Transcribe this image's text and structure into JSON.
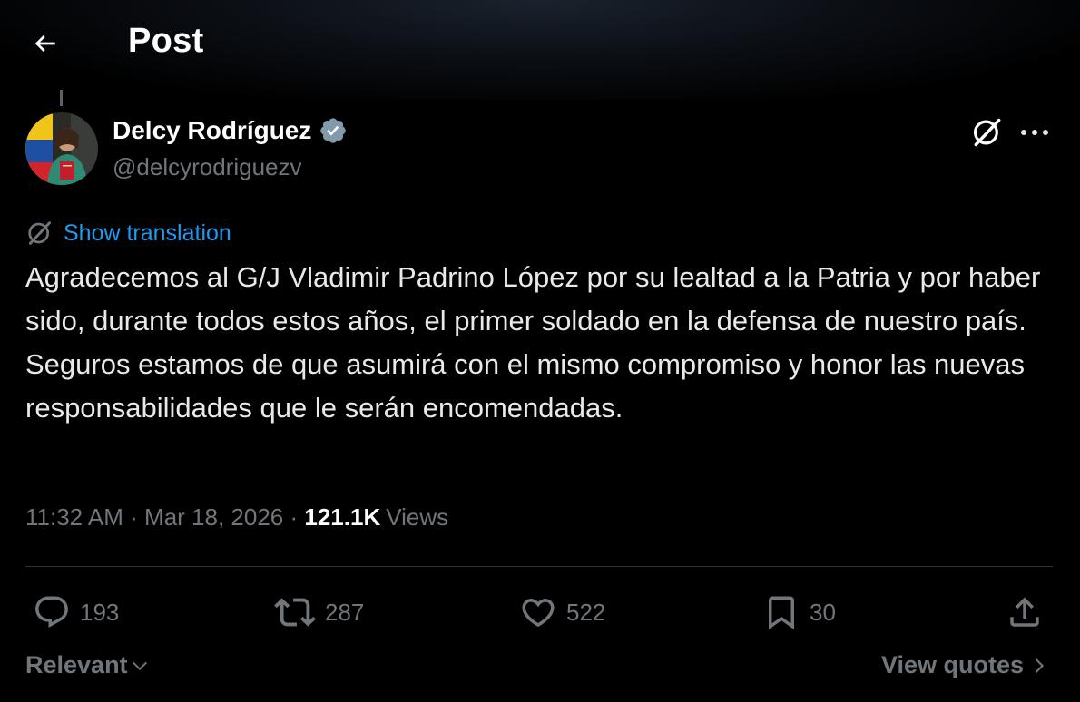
{
  "header": {
    "title": "Post"
  },
  "author": {
    "name": "Delcy Rodríguez",
    "handle": "@delcyrodriguezv",
    "verified": true
  },
  "translate": {
    "label": "Show translation"
  },
  "post": {
    "text": "Agradecemos al G/J Vladimir Padrino López por su lealtad a la Patria y por haber sido, durante todos estos años, el primer soldado en la defensa de nuestro país. Seguros estamos de que asumirá con el mismo compromiso y honor las nuevas responsabilidades que le serán encomendadas."
  },
  "meta": {
    "time": "11:32 AM",
    "date": "Mar 18, 2026",
    "views": "121.1K",
    "views_label": "Views"
  },
  "actions": {
    "replies": "193",
    "reposts": "287",
    "likes": "522",
    "bookmarks": "30"
  },
  "footer": {
    "sort_label": "Relevant",
    "quotes_label": "View quotes"
  },
  "colors": {
    "background": "#000000",
    "text": "#e7e9ea",
    "secondary": "#71767b",
    "link": "#1d9bf0",
    "divider": "#2f3336"
  },
  "icons": [
    "back-arrow-icon",
    "verified-badge-icon",
    "grok-icon",
    "more-icon",
    "translate-icon",
    "reply-icon",
    "repost-icon",
    "like-icon",
    "bookmark-icon",
    "share-icon",
    "chevron-down-icon",
    "chevron-right-icon"
  ]
}
